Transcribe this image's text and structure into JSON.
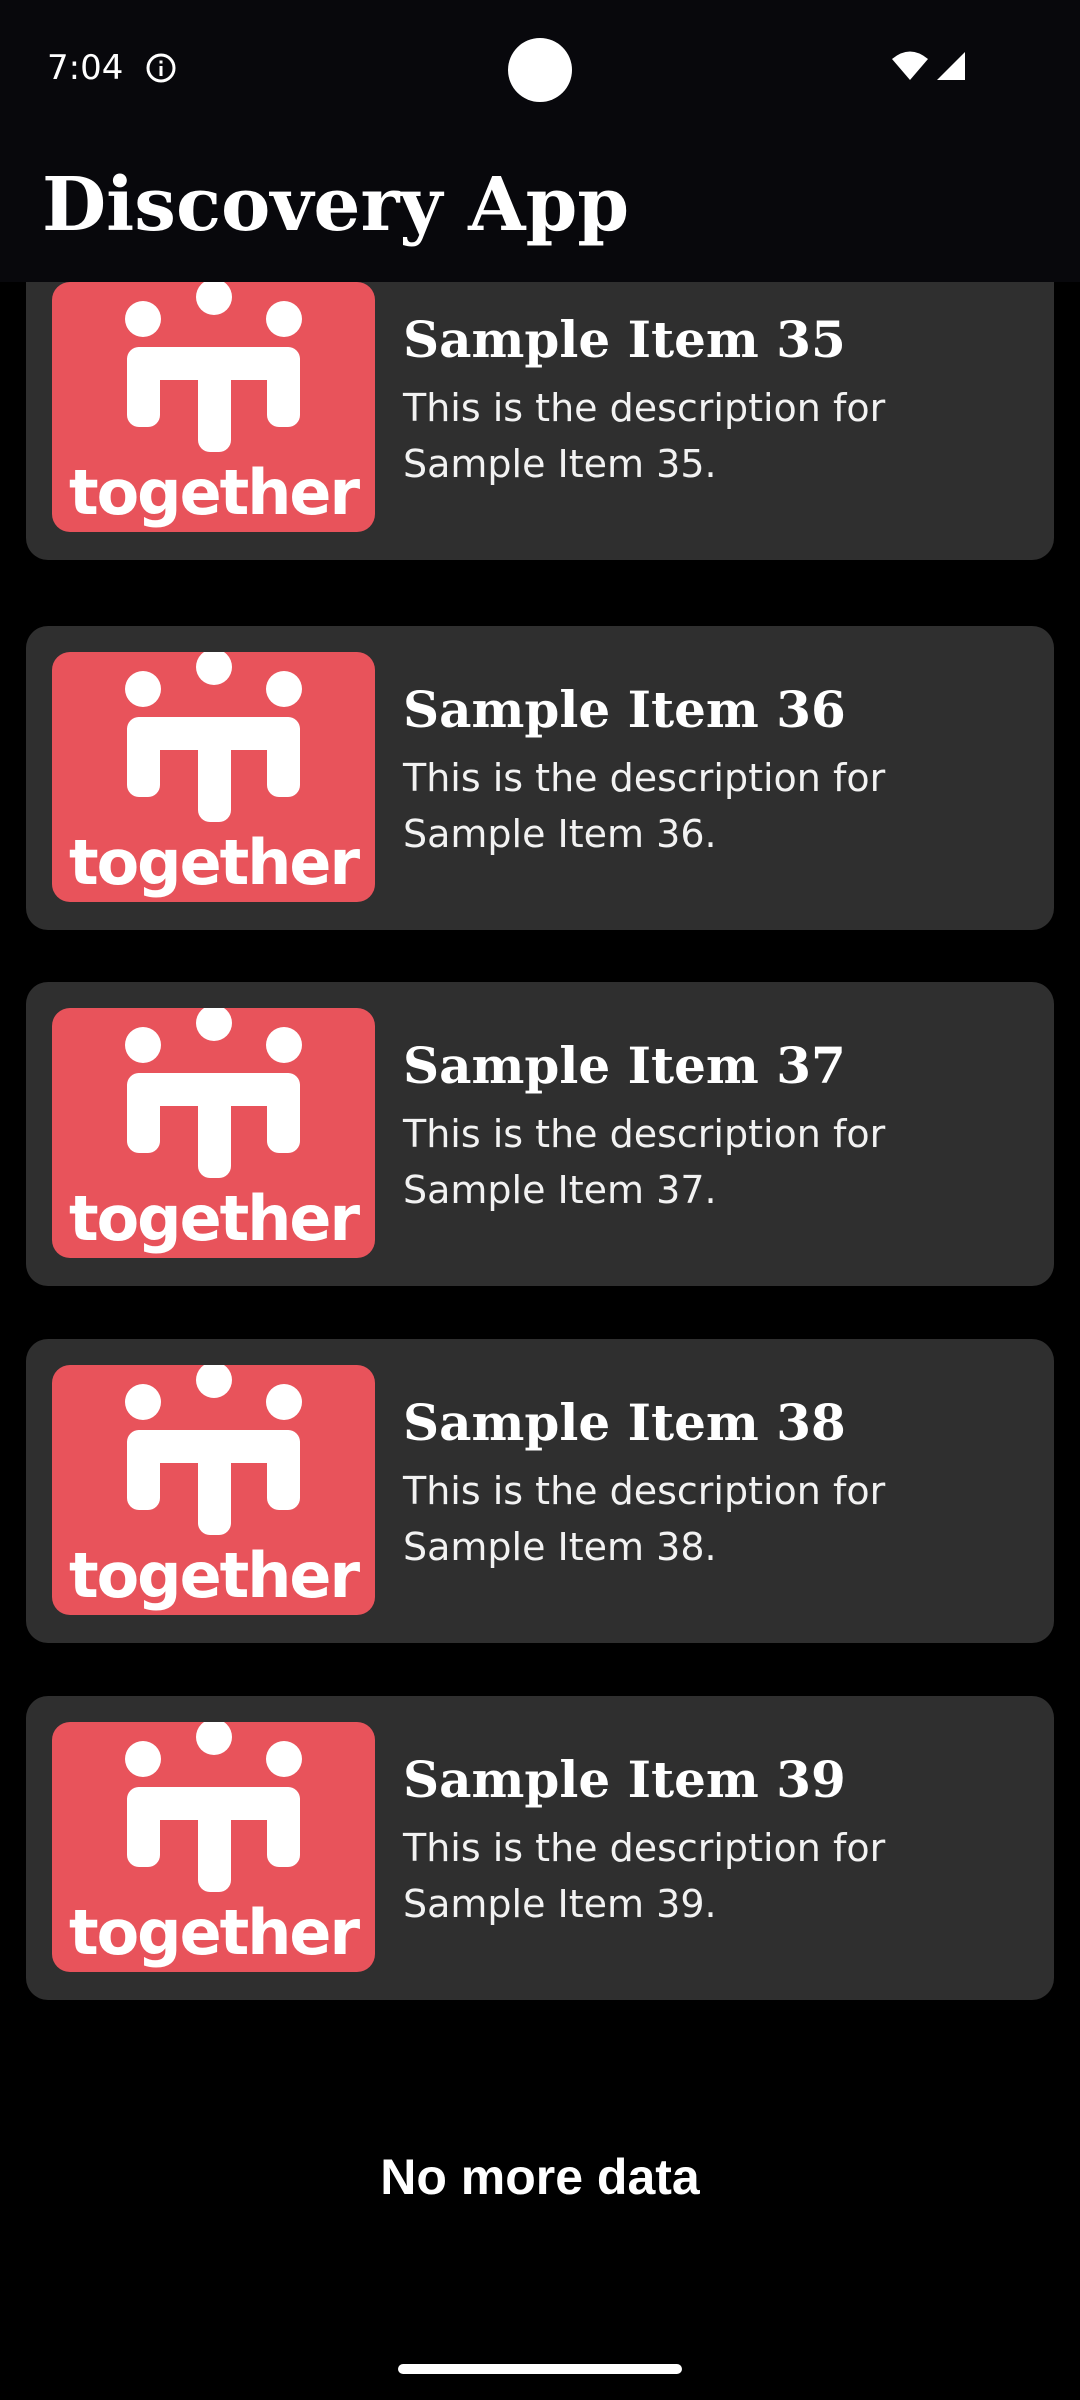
{
  "status_bar": {
    "time": "7:04",
    "icons": [
      "info-icon",
      "wifi-icon",
      "signal-icon"
    ]
  },
  "app_bar": {
    "title": "Discovery App"
  },
  "items": [
    {
      "title": "Sample Item 35",
      "description": "This is the description for Sample Item 35.",
      "thumbnail_text": "together"
    },
    {
      "title": "Sample Item 36",
      "description": "This is the description for Sample Item 36.",
      "thumbnail_text": "together"
    },
    {
      "title": "Sample Item 37",
      "description": "This is the description for Sample Item 37.",
      "thumbnail_text": "together"
    },
    {
      "title": "Sample Item 38",
      "description": "This is the description for Sample Item 38.",
      "thumbnail_text": "together"
    },
    {
      "title": "Sample Item 39",
      "description": "This is the description for Sample Item 39.",
      "thumbnail_text": "together"
    }
  ],
  "footer": {
    "message": "No more data"
  },
  "colors": {
    "background": "#000000",
    "app_bar": "#08080c",
    "card": "#2f2f2f",
    "thumbnail": "#e8535b",
    "text": "#ffffff"
  }
}
